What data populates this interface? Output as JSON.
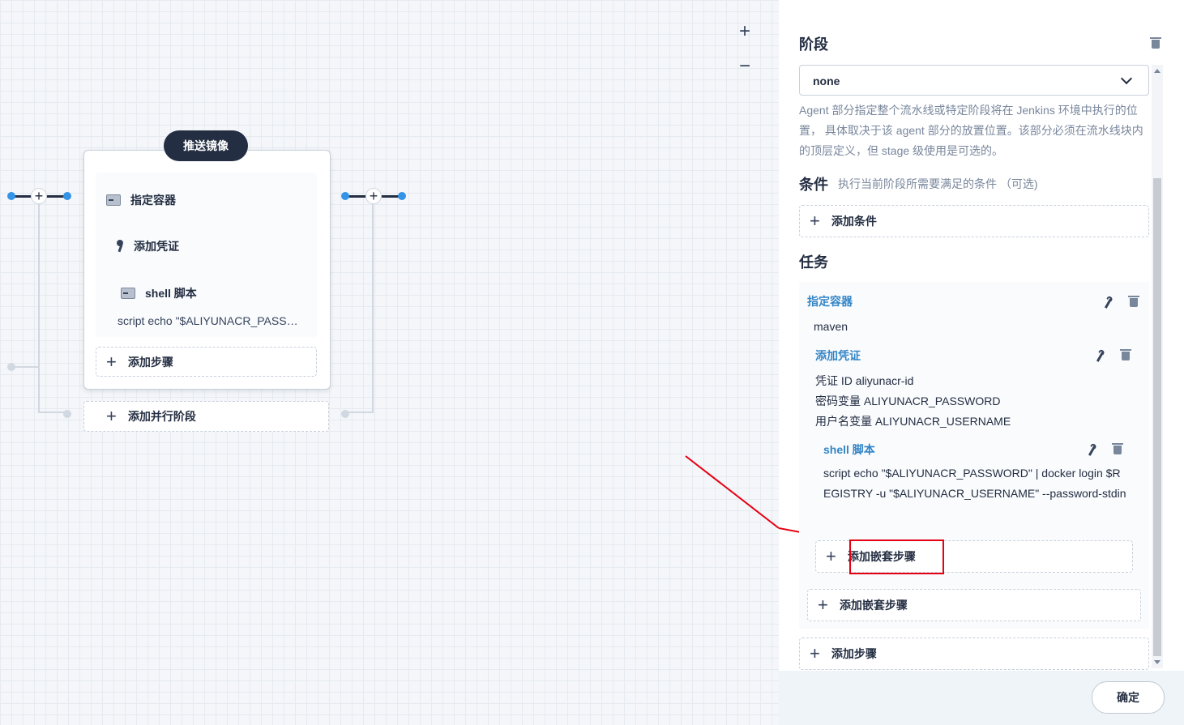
{
  "canvas": {
    "zoom_in": "+",
    "zoom_out": "−",
    "stage": {
      "title": "推送镜像",
      "steps": [
        {
          "label": "指定容器",
          "icon": "terminal-icon"
        },
        {
          "label": "添加凭证",
          "icon": "key-icon"
        },
        {
          "label": "shell 脚本",
          "icon": "terminal-icon"
        }
      ],
      "script_line": "script   echo \"$ALIYUNACR_PASSWORD\" | docker login $REGISTRY",
      "add_step": "添加步骤",
      "add_parallel": "添加并行阶段"
    }
  },
  "panel": {
    "stage_heading": "阶段",
    "agent_select": "none",
    "agent_desc": "Agent 部分指定整个流水线或特定阶段将在 Jenkins 环境中执行的位置， 具体取决于该 agent 部分的放置位置。该部分必须在流水线块内的顶层定义，但 stage 级使用是可选的。",
    "condition_heading": "条件",
    "condition_hint": "执行当前阶段所需要满足的条件 （可选)",
    "add_condition": "添加条件",
    "task_heading": "任务",
    "tasks": {
      "container": {
        "title": "指定容器",
        "value": "maven"
      },
      "credential": {
        "title": "添加凭证",
        "id_line": "凭证 ID   aliyunacr-id",
        "pwd_line": "密码变量   ALIYUNACR_PASSWORD",
        "user_line": "用户名变量   ALIYUNACR_USERNAME"
      },
      "shell": {
        "title": "shell 脚本",
        "script": "script   echo \"$ALIYUNACR_PASSWORD\" | docker login $REGISTRY -u \"$ALIYUNACR_USERNAME\" --password-stdin"
      },
      "add_nested_inner": "添加嵌套步骤",
      "add_nested_outer": "添加嵌套步骤"
    },
    "add_step": "添加步骤",
    "confirm": "确定"
  },
  "colors": {
    "accent": "#3385c6",
    "dark": "#242e42",
    "highlight": "#e60012",
    "node": "#3393e6"
  }
}
